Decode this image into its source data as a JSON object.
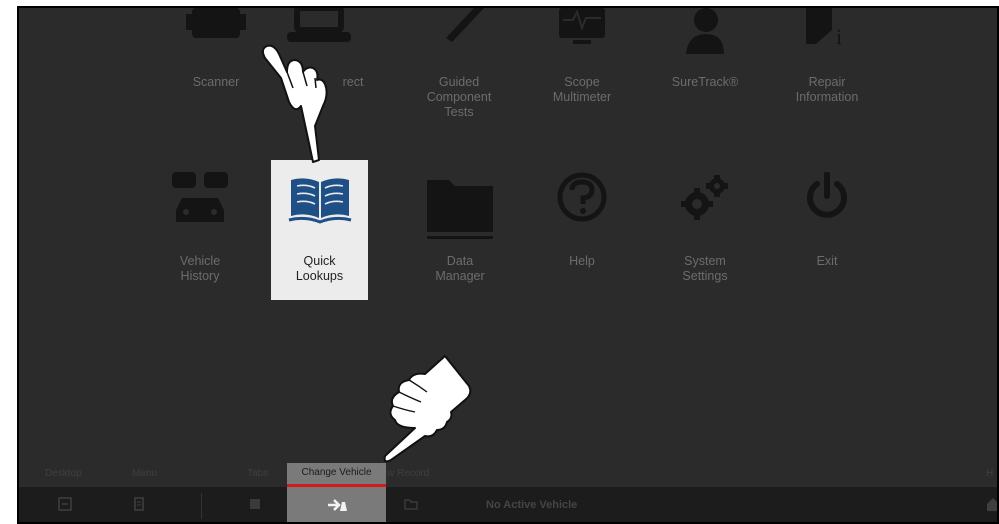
{
  "top_row": [
    {
      "name": "scanner",
      "lines": [
        "Scanner"
      ]
    },
    {
      "name": "fast-track",
      "lines": [
        "rect"
      ]
    },
    {
      "name": "guided-component-tests",
      "lines": [
        "Guided",
        "Component",
        "Tests"
      ]
    },
    {
      "name": "scope-multimeter",
      "lines": [
        "Scope",
        "Multimeter"
      ]
    },
    {
      "name": "suretrack",
      "lines": [
        "SureTrack®"
      ]
    },
    {
      "name": "repair-information",
      "lines": [
        "Repair",
        "Information"
      ]
    }
  ],
  "bottom_row": [
    {
      "name": "vehicle-history",
      "lines": [
        "Vehicle",
        "History"
      ]
    },
    {
      "name": "quick-lookups",
      "lines": [
        "Quick",
        "Lookups"
      ]
    },
    {
      "name": "data-manager",
      "lines": [
        "Data",
        "Manager"
      ]
    },
    {
      "name": "help",
      "lines": [
        "Help"
      ]
    },
    {
      "name": "system-settings",
      "lines": [
        "System",
        "Settings"
      ]
    },
    {
      "name": "exit",
      "lines": [
        "Exit"
      ]
    }
  ],
  "bottom_tabs": {
    "desktop": "Desktop",
    "menu": "Menu",
    "tabs": "Tabs",
    "change_vehicle": "Change Vehicle",
    "view_record": "w Record",
    "right_partial": "H"
  },
  "toolbar": {
    "status": "No Active Vehicle"
  },
  "colors": {
    "background": "#2b2b2b",
    "highlight_tile": "#ececec",
    "accent_blue": "#1e4f86",
    "selected_tab": "#7a7a7a",
    "red_indicator": "#d21c1c"
  }
}
